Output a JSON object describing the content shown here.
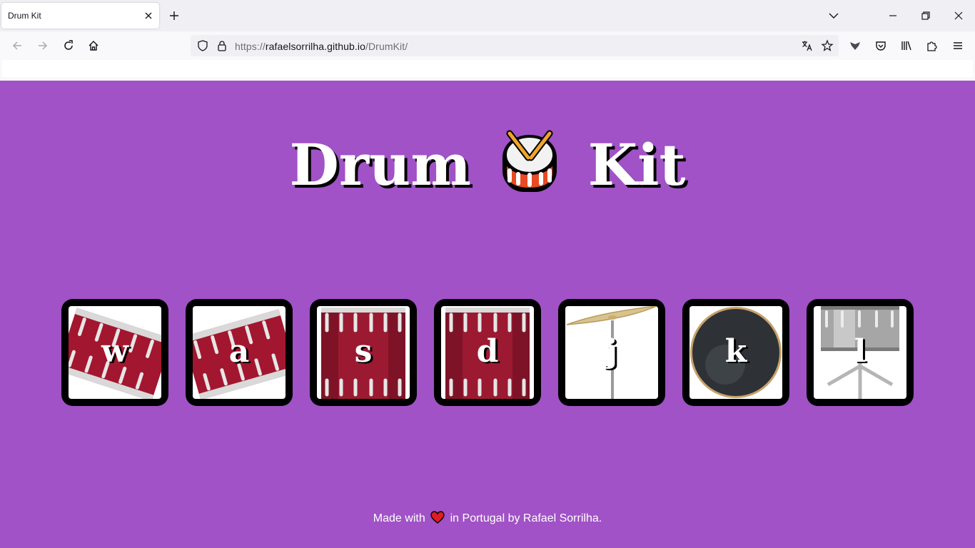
{
  "browser": {
    "tab_title": "Drum Kit",
    "url": {
      "protocol": "https://",
      "host": "rafaelsorrilha.github.io",
      "path": "/DrumKit/"
    }
  },
  "page": {
    "title_left": "Drum",
    "title_right": "Kit",
    "title_emoji": "drum-icon",
    "background": "#a052c6",
    "drums": [
      {
        "key": "w",
        "instrument": "tom-1"
      },
      {
        "key": "a",
        "instrument": "tom-2"
      },
      {
        "key": "s",
        "instrument": "tom-3"
      },
      {
        "key": "d",
        "instrument": "tom-4"
      },
      {
        "key": "j",
        "instrument": "crash"
      },
      {
        "key": "k",
        "instrument": "kick"
      },
      {
        "key": "l",
        "instrument": "snare"
      }
    ],
    "footer": {
      "before": "Made with",
      "icon": "heart-icon",
      "after": "in Portugal by Rafael Sorrilha."
    }
  }
}
